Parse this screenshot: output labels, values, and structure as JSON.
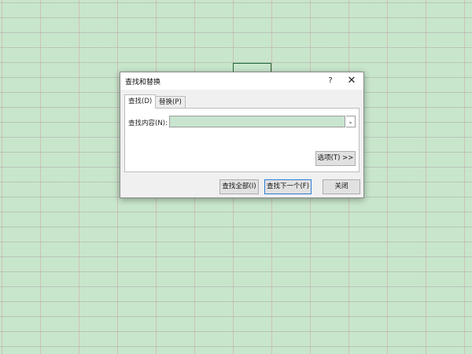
{
  "dialog": {
    "title": "查找和替换",
    "help_label": "?",
    "close_label": "✕"
  },
  "tabs": [
    {
      "label": "查找(D)",
      "active": true
    },
    {
      "label": "替换(P)",
      "active": false
    }
  ],
  "find": {
    "label": "查找内容(N):",
    "value": "",
    "dropdown_icon": "chevron-down-icon"
  },
  "buttons": {
    "options": "选项(T) >>",
    "find_all": "查找全部(I)",
    "find_next": "查找下一个(F)",
    "close": "关闭"
  },
  "colors": {
    "sheet_background": "#c8e6cc",
    "input_background": "#c9e5cf",
    "default_button_border": "#2f7ed8",
    "active_cell_border": "#1e6b33"
  }
}
